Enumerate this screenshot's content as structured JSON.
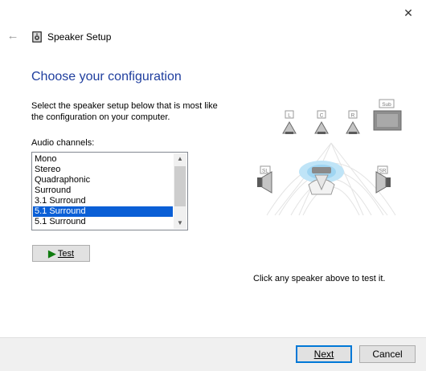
{
  "window": {
    "title": "Speaker Setup",
    "close_glyph": "✕",
    "back_glyph": "←"
  },
  "main": {
    "heading": "Choose your configuration",
    "instructions": "Select the speaker setup below that is most like the configuration on your computer.",
    "list_label": "Audio channels:",
    "channels": [
      "Mono",
      "Stereo",
      "Quadraphonic",
      "Surround",
      "3.1 Surround",
      "5.1 Surround",
      "5.1 Surround"
    ],
    "selected_index": 5,
    "test_button": {
      "icon": "play-icon",
      "label": "Test"
    },
    "hint": "Click any speaker above to test it."
  },
  "speakers": {
    "front_left": "L",
    "center": "C",
    "front_right": "R",
    "subwoofer": "Sub",
    "side_left": "SL",
    "side_right": "SR"
  },
  "footer": {
    "next_label": "Next",
    "cancel_label": "Cancel"
  },
  "colors": {
    "heading": "#1f3e9e",
    "selection": "#0a5fd6",
    "accent": "#0078d7",
    "play_icon": "#0f7b0f"
  }
}
